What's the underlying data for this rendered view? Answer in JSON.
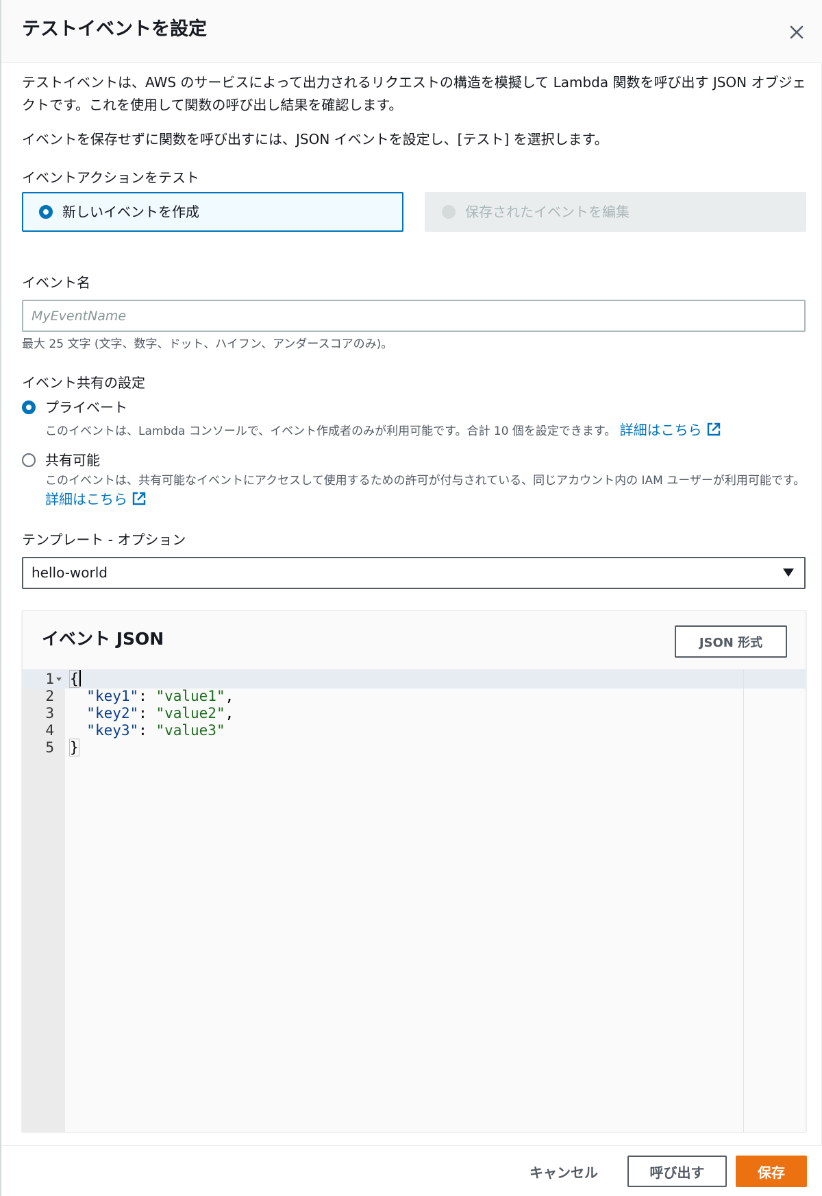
{
  "modal": {
    "title": "テストイベントを設定",
    "close_icon": "close-icon"
  },
  "description": {
    "p1": "テストイベントは、AWS のサービスによって出力されるリクエストの構造を模擬して Lambda 関数を呼び出す JSON オブジェクトです。これを使用して関数の呼び出し結果を確認します。",
    "p2": "イベントを保存せずに関数を呼び出すには、JSON イベントを設定し、[テスト] を選択します。"
  },
  "test_event_action": {
    "label": "イベントアクションをテスト",
    "options": [
      {
        "label": "新しいイベントを作成",
        "selected": true,
        "disabled": false
      },
      {
        "label": "保存されたイベントを編集",
        "selected": false,
        "disabled": true
      }
    ]
  },
  "event_name": {
    "label": "イベント名",
    "value": "",
    "placeholder": "MyEventName",
    "hint": "最大 25 文字 (文字、数字、ドット、ハイフン、アンダースコアのみ)。"
  },
  "sharing": {
    "label": "イベント共有の設定",
    "private": {
      "label": "プライベート",
      "selected": true,
      "description": "このイベントは、Lambda コンソールで、イベント作成者のみが利用可能です。合計 10 個を設定できます。",
      "link": "詳細はこちら"
    },
    "shareable": {
      "label": "共有可能",
      "selected": false,
      "description": "このイベントは、共有可能なイベントにアクセスして使用するための許可が付与されている、同じアカウント内の IAM ユーザーが利用可能です。",
      "link": "詳細はこちら"
    },
    "external_link_icon": "external-link-icon"
  },
  "template": {
    "label": "テンプレート - オプション",
    "selected": "hello-world",
    "caret_icon": "caret-down-icon"
  },
  "event_json": {
    "title": "イベント JSON",
    "format_button": "JSON 形式",
    "lines": [
      {
        "num": "1",
        "text": "{"
      },
      {
        "num": "2",
        "key": "\"key1\"",
        "value": "\"value1\"",
        "trail": ","
      },
      {
        "num": "3",
        "key": "\"key2\"",
        "value": "\"value2\"",
        "trail": ","
      },
      {
        "num": "4",
        "key": "\"key3\"",
        "value": "\"value3\"",
        "trail": ""
      },
      {
        "num": "5",
        "text": "}"
      }
    ],
    "fold_icon": "fold-arrow-icon"
  },
  "footer": {
    "cancel": "キャンセル",
    "invoke": "呼び出す",
    "save": "保存"
  },
  "colors": {
    "accent": "#0073bb",
    "primary_button": "#ec7211",
    "text": "#16191f",
    "secondary_text": "#545b64"
  }
}
